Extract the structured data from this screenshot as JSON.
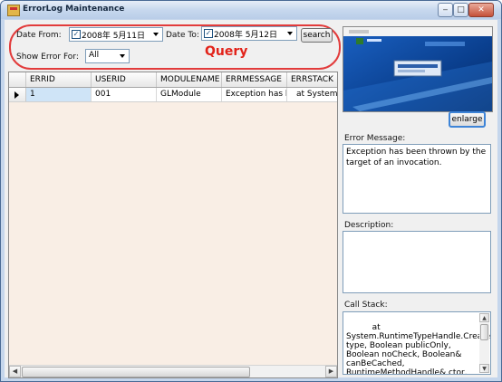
{
  "window": {
    "title": "ErrorLog Maintenance"
  },
  "query": {
    "date_from_label": "Date From:",
    "date_from_value": "2008年  5月11日",
    "date_to_label": "Date To:",
    "date_to_value": "2008年  5月12日",
    "search_label": "search",
    "show_error_label": "Show Error For:",
    "show_error_value": "All",
    "annotation": "Query"
  },
  "grid": {
    "columns": [
      "ERRID",
      "USERID",
      "MODULENAME",
      "ERRMESSAGE",
      "ERRSTACK"
    ],
    "rows": [
      [
        "1",
        "001",
        "GLModule",
        "Exception has be...",
        "at System.Runti"
      ]
    ]
  },
  "preview": {
    "enlarge_label": "enlarge"
  },
  "details": {
    "error_message_label": "Error Message:",
    "error_message": "Exception has been thrown by the target of an invocation.",
    "description_label": "Description:",
    "description": "",
    "call_stack_label": "Call Stack:",
    "call_stack": "    at System.RuntimeTypeHandle.CreateInstance(RuntimeType type, Boolean publicOnly, Boolean noCheck, Boolean& canBeCached, RuntimeMethodHandle& ctor, Boolean& bNeedSecurityCheck)\n    at"
  },
  "colors": {
    "query_highlight": "#e23b3b",
    "grid_background": "#f9eee5",
    "selected_cell": "#cfe4f7"
  },
  "icons": {
    "window_icon": "app-icon",
    "minimize": "minimize-icon",
    "maximize": "maximize-icon",
    "close": "close-icon"
  }
}
